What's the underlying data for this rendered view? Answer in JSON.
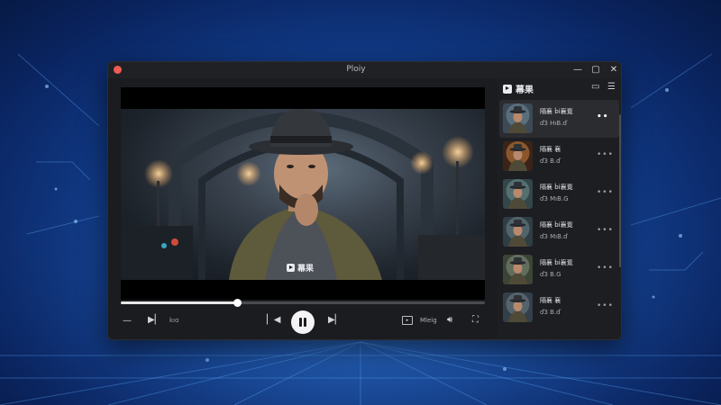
{
  "window": {
    "title": "Ploiy"
  },
  "video": {
    "watermark": "幕果"
  },
  "playback": {
    "progress": 0.32
  },
  "controls": {
    "time_text": "kıɑ",
    "mode_label": "Mleig"
  },
  "sidebar": {
    "title": "幕果",
    "items": [
      {
        "title": "隔襄 ḃi襄覔",
        "meta": "ď3 HıB.ď",
        "active": true
      },
      {
        "title": "隔襄 襄",
        "meta": "ď3 B.ď",
        "active": false
      },
      {
        "title": "隔襄 ḃi襄覔",
        "meta": "ď3 MıB.G",
        "active": false
      },
      {
        "title": "隔襄 ḃi襄覔",
        "meta": "ď3 MıB.ď",
        "active": false
      },
      {
        "title": "隔襄 ḃi襄覔",
        "meta": "ď3 B.G",
        "active": false
      },
      {
        "title": "隔襄 襄",
        "meta": "ď3 B.ď",
        "active": false
      }
    ]
  },
  "colors": {
    "accent": "#f4f4f6",
    "close": "#ee5b52",
    "window_bg": "#1b1c1f"
  }
}
